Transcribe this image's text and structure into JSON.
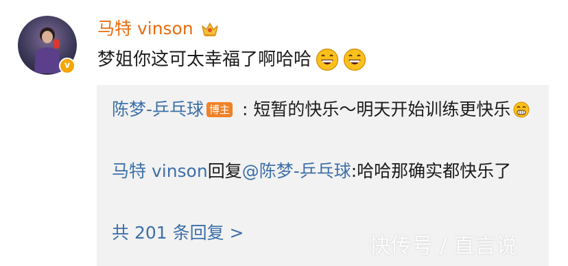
{
  "comment": {
    "username": "马特 vinson",
    "text": "梦姐你这可太幸福了啊哈哈",
    "verified_badge": "v",
    "avatar_icon": "user-avatar",
    "crown_icon": "crown-icon",
    "emojis": [
      "grinning-emoji",
      "grinning-emoji"
    ]
  },
  "replies": [
    {
      "author": "陈梦-乒乓球",
      "author_tag": "博主",
      "separator": " : ",
      "text": "短暂的快乐～明天开始训练更快乐",
      "emoji": "grin-teeth-emoji"
    },
    {
      "author": "马特 vinson",
      "action": "回复",
      "mention": "@陈梦-乒乓球",
      "text": ":哈哈那确实都快乐了"
    }
  ],
  "more_replies_label": "共 201 条回复 >",
  "watermark": "快传号 / 直言说",
  "colors": {
    "username": "#e86b0c",
    "link": "#3c6fa8",
    "tag_bg": "#f18126",
    "reply_bg": "#f2f2f2",
    "badge": "#f5a500"
  }
}
